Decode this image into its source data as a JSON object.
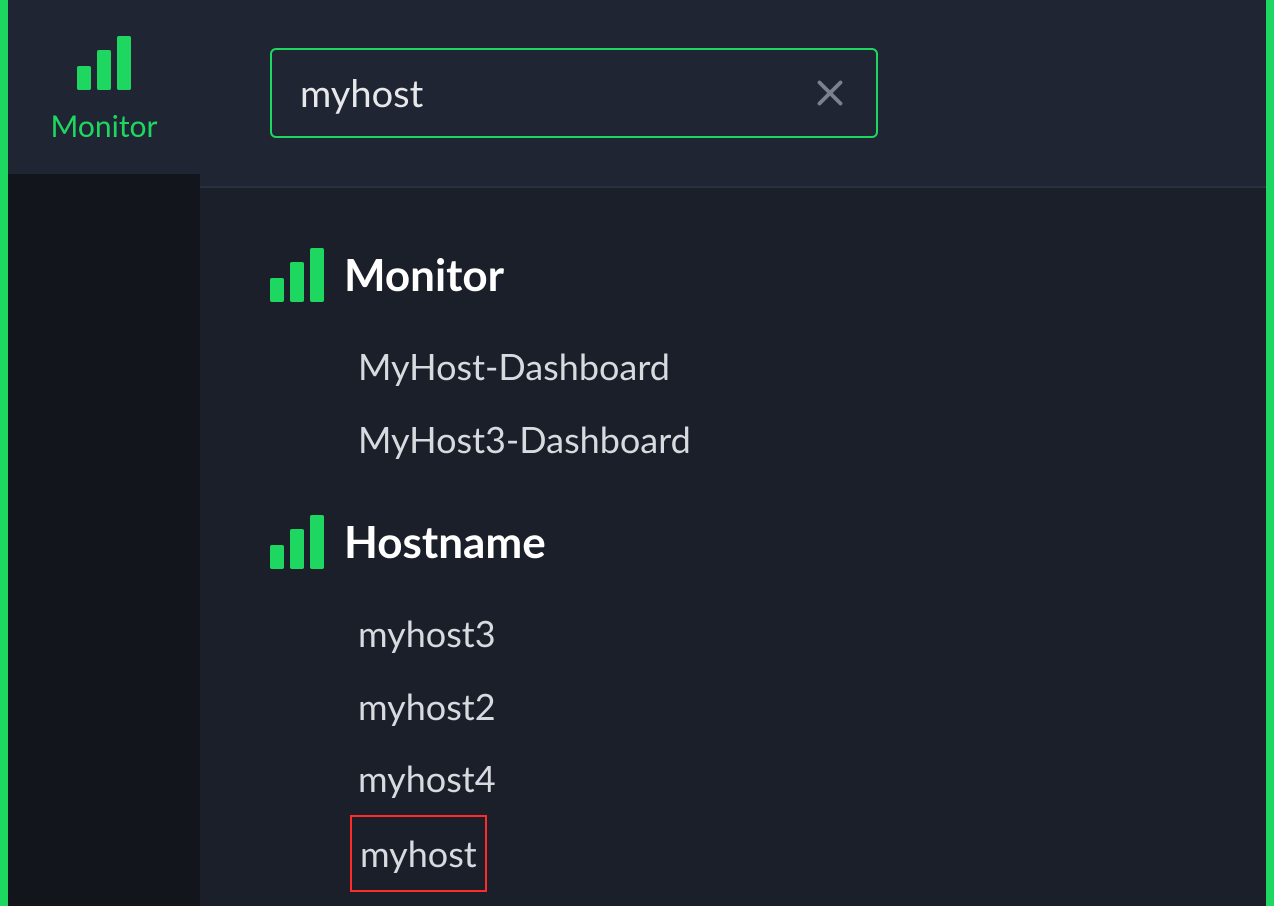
{
  "colors": {
    "accent": "#1ed760",
    "bg_dark": "#12151c",
    "bg_panel": "#1f2532",
    "bg_main": "#1a1f2a",
    "highlight": "#ff2b2b"
  },
  "sidebar": {
    "monitor_label": "Monitor"
  },
  "search": {
    "value": "myhost",
    "placeholder": ""
  },
  "sections": [
    {
      "title": "Monitor",
      "icon": "bars-icon",
      "items": [
        {
          "label": "MyHost-Dashboard",
          "highlighted": false
        },
        {
          "label": "MyHost3-Dashboard",
          "highlighted": false
        }
      ]
    },
    {
      "title": "Hostname",
      "icon": "bars-icon",
      "items": [
        {
          "label": "myhost3",
          "highlighted": false
        },
        {
          "label": "myhost2",
          "highlighted": false
        },
        {
          "label": "myhost4",
          "highlighted": false
        },
        {
          "label": "myhost",
          "highlighted": true
        }
      ]
    }
  ]
}
